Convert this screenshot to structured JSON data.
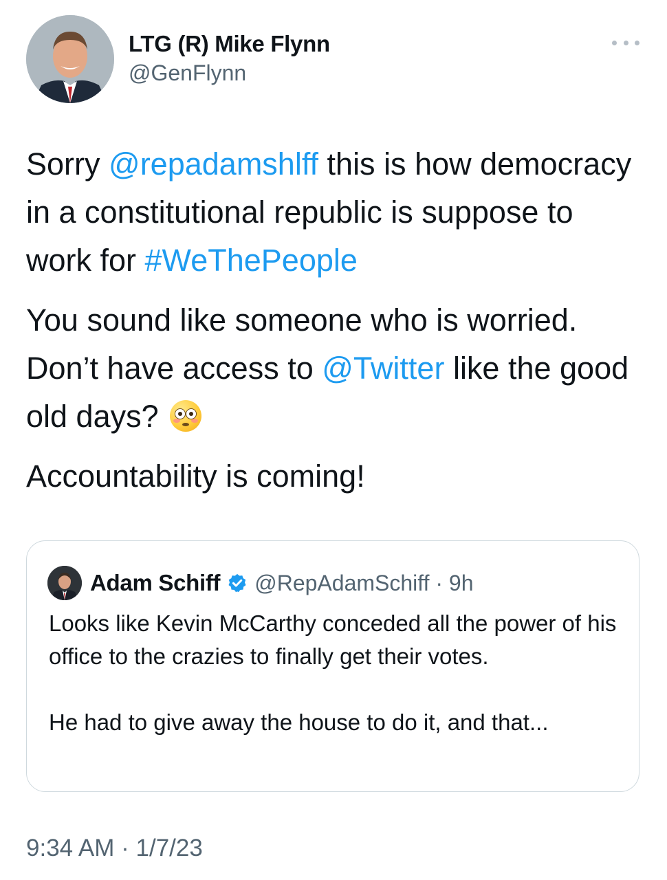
{
  "author": {
    "name": "LTG (R) Mike Flynn",
    "handle": "@GenFlynn"
  },
  "tweet": {
    "p1": {
      "pre": "Sorry ",
      "mention": "@repadamshlff",
      "mid": " this is how democracy in a constitutional republic is suppose to work for ",
      "hashtag": "#WeThePeople"
    },
    "p2": {
      "pre": "You sound like someone who is worried. Don’t have access to ",
      "mention": "@Twitter",
      "post": " like the good old days?",
      "emoji": "flushed-face-emoji"
    },
    "p3": "Accountability is coming!"
  },
  "quote": {
    "name": "Adam Schiff",
    "handle_time": "@RepAdamSchiff · 9h",
    "verified": true,
    "p1": "Looks like Kevin McCarthy conceded all the power of his office to the crazies to finally get their votes.",
    "p2": "He had to give away the house to do it, and that..."
  },
  "timestamp": "9:34 AM · 1/7/23",
  "colors": {
    "link": "#1d9bf0",
    "secondary_text": "#536471",
    "border": "#cfd9de"
  }
}
